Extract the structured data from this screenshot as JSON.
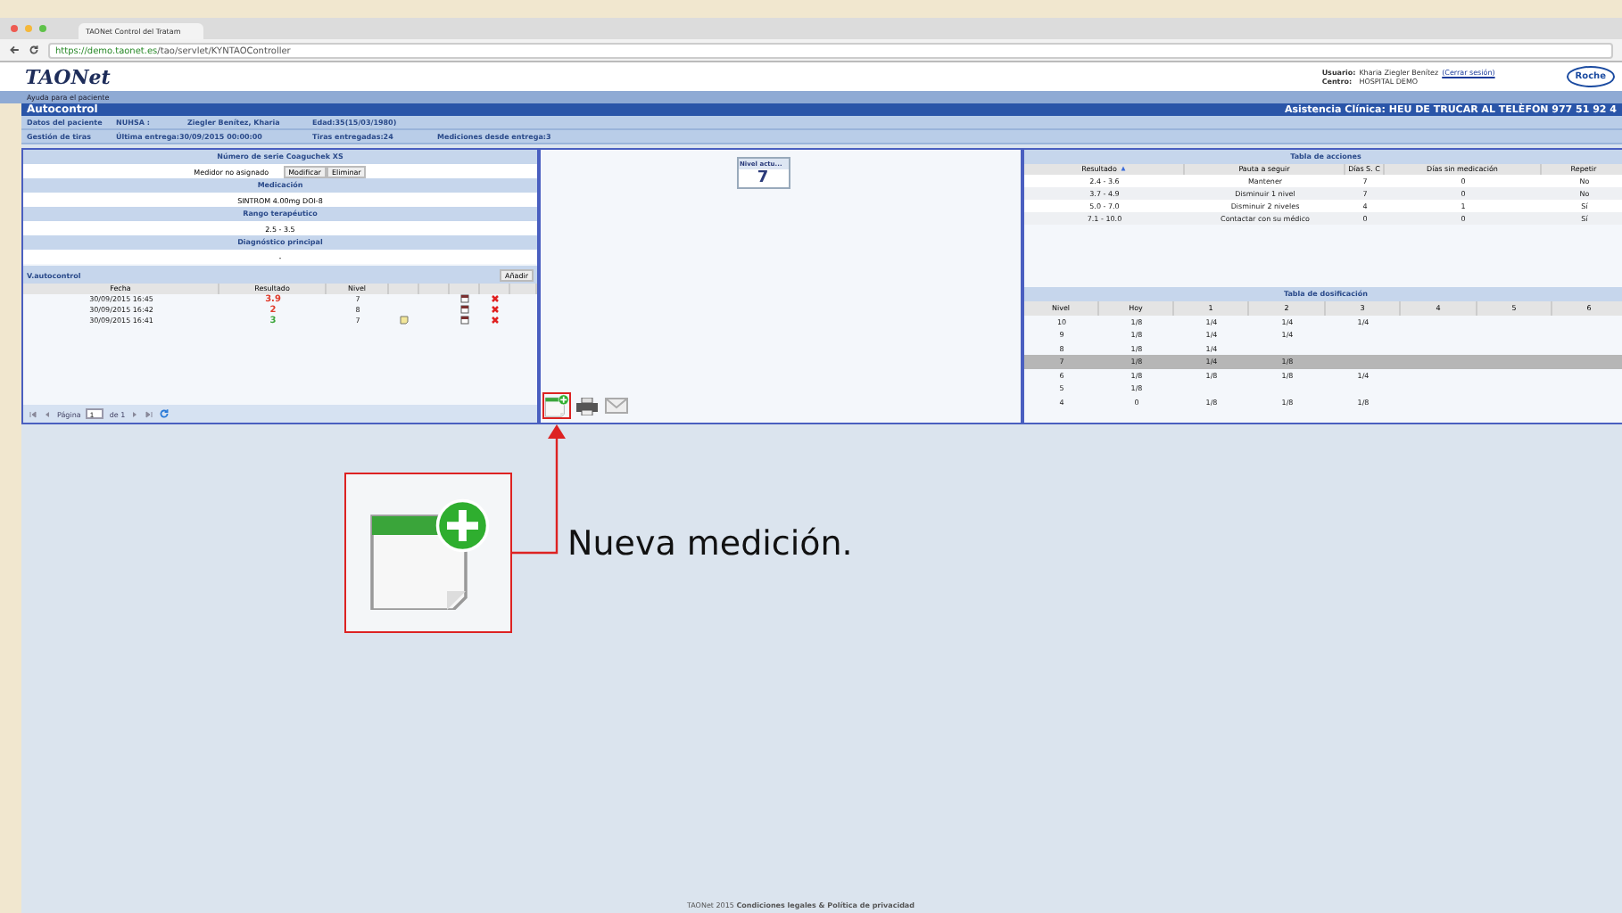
{
  "browser": {
    "tab_title": "TAONet Control del Tratam",
    "url_host": "https://demo.taonet.es",
    "url_path": "/tao/servlet/KYNTAOController"
  },
  "header": {
    "logo": "TAONet",
    "user_label": "Usuario:",
    "user": "Kharia Ziegler Benítez",
    "logout": "(Cerrar sesión)",
    "center_label": "Centro:",
    "center": "HOSPITAL DEMO",
    "brand": "Roche"
  },
  "help_link": "Ayuda para el paciente",
  "title_bar": {
    "title": "Autocontrol",
    "notice": "Asistencia Clínica: HEU DE TRUCAR AL TELÈFON 977 51 92 4"
  },
  "info_rows": [
    [
      "Datos del paciente",
      "NUHSA :",
      "Ziegler Benítez, Kharia",
      "Edad:35(15/03/1980)"
    ],
    [
      "Gestión de tiras",
      "Última entrega:30/09/2015 00:00:00",
      "Tiras entregadas:24",
      "Mediciones desde entrega:3"
    ]
  ],
  "sections": [
    {
      "heading": "Número de serie Coaguchek XS",
      "value": "Medidor no asignado",
      "buttons": [
        "Modificar",
        "Eliminar"
      ]
    },
    {
      "heading": "Medicación",
      "value": "SINTROM 4.00mg DOI-8"
    },
    {
      "heading": "Rango terapéutico",
      "value": "2.5 - 3.5"
    },
    {
      "heading": "Diagnóstico principal",
      "value": "-"
    }
  ],
  "measurements": {
    "title": "V.autocontrol",
    "add_button": "Añadir",
    "columns": [
      "Fecha",
      "Resultado",
      "Nivel"
    ],
    "rows": [
      {
        "date": "30/09/2015 16:45",
        "result": "3.9",
        "color": "#e03c2c",
        "level": "7",
        "note": false
      },
      {
        "date": "30/09/2015 16:42",
        "result": "2",
        "color": "#e03c2c",
        "level": "8",
        "note": false
      },
      {
        "date": "30/09/2015 16:41",
        "result": "3",
        "color": "#3aa53a",
        "level": "7",
        "note": true
      }
    ],
    "pager": {
      "page_label": "Página",
      "page": "1",
      "of": "de 1"
    }
  },
  "level_box": {
    "title": "Nivel actu...",
    "value": "7"
  },
  "actions_table": {
    "title": "Tabla de acciones",
    "columns": [
      "Resultado",
      "Pauta a seguir",
      "Días S. C",
      "Días sin medicación",
      "Repetir"
    ],
    "rows": [
      [
        "2.4 - 3.6",
        "Mantener",
        "7",
        "0",
        "No"
      ],
      [
        "3.7 - 4.9",
        "Disminuir 1 nivel",
        "7",
        "0",
        "No"
      ],
      [
        "5.0 - 7.0",
        "Disminuir 2 niveles",
        "4",
        "1",
        "Sí"
      ],
      [
        "7.1 - 10.0",
        "Contactar con su médico",
        "0",
        "0",
        "Sí"
      ]
    ]
  },
  "dosing_table": {
    "title": "Tabla de dosificación",
    "columns": [
      "Nivel",
      "Hoy",
      "1",
      "2",
      "3",
      "4",
      "5",
      "6"
    ],
    "rows": [
      {
        "selected": false,
        "cells": [
          "10",
          "1/8",
          "1/4",
          "1/4",
          "1/4"
        ]
      },
      {
        "selected": false,
        "cells": [
          "9",
          "1/8",
          "1/4",
          "1/4"
        ]
      },
      {
        "selected": false,
        "cells": [
          "8",
          "1/8",
          "1/4"
        ]
      },
      {
        "selected": true,
        "cells": [
          "7",
          "1/8",
          "1/4",
          "1/8"
        ]
      },
      {
        "selected": false,
        "cells": [
          "6",
          "1/8",
          "1/8",
          "1/8",
          "1/4"
        ]
      },
      {
        "selected": false,
        "cells": [
          "5",
          "1/8"
        ]
      },
      {
        "selected": false,
        "cells": [
          "4",
          "0",
          "1/8",
          "1/8",
          "1/8"
        ]
      }
    ]
  },
  "callout": {
    "text": "Nueva medición."
  },
  "footer": {
    "copyright": "TAONet 2015",
    "links": "Condiciones legales & Política de privacidad"
  }
}
